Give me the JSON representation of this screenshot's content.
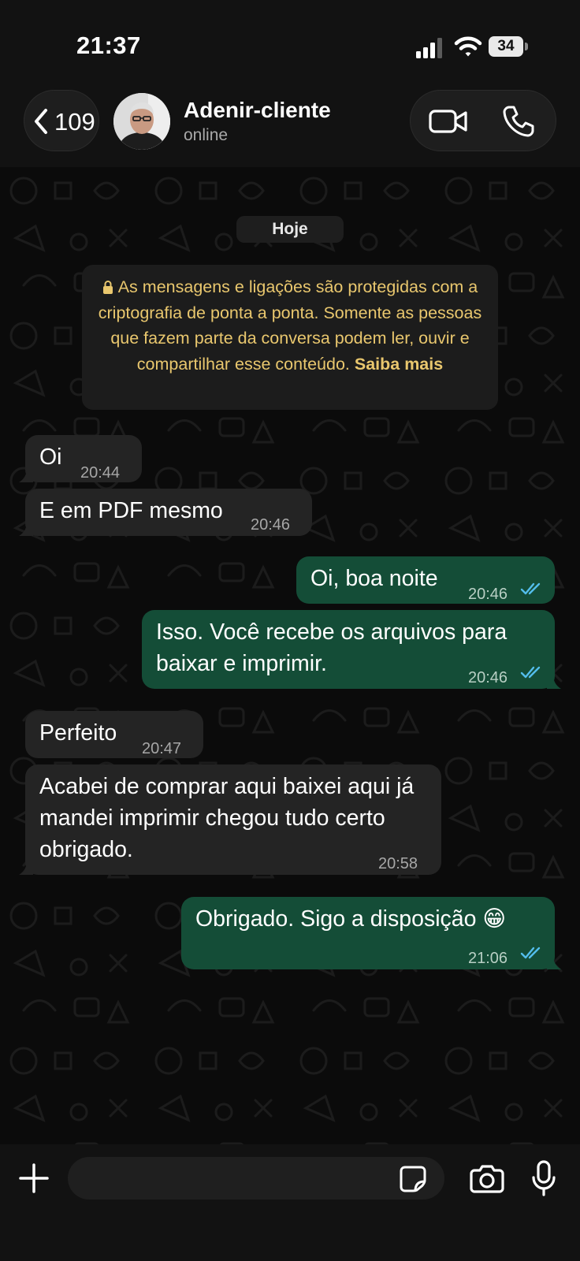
{
  "status_bar": {
    "time": "21:37",
    "battery": "34",
    "icons": [
      "signal-icon",
      "wifi-icon",
      "battery-icon"
    ]
  },
  "header": {
    "back_count": "109",
    "contact_name": "Adenir-cliente",
    "contact_status": "online",
    "icons": [
      "chevron-left-icon",
      "video-call-icon",
      "phone-call-icon"
    ]
  },
  "chat": {
    "date_label": "Hoje",
    "encryption_notice": {
      "text": "As mensagens e ligações são protegidas com a criptografia de ponta a ponta. Somente as pessoas que fazem parte da conversa podem ler, ouvir e compartilhar esse conteúdo.",
      "link": "Saiba mais"
    },
    "messages": [
      {
        "direction": "in",
        "text": "Oi",
        "time": "20:44"
      },
      {
        "direction": "in",
        "text": "E em PDF mesmo",
        "time": "20:46"
      },
      {
        "direction": "out",
        "text": "Oi, boa noite",
        "time": "20:46",
        "status": "read"
      },
      {
        "direction": "out",
        "text": "Isso. Você recebe os arquivos para baixar e imprimir.",
        "time": "20:46",
        "status": "read"
      },
      {
        "direction": "in",
        "text": "Perfeito",
        "time": "20:47"
      },
      {
        "direction": "in",
        "text": "Acabei de comprar aqui baixei aqui já mandei imprimir chegou tudo certo obrigado.",
        "time": "20:58"
      },
      {
        "direction": "out",
        "text": "Obrigado. Sigo a disposição 😁",
        "time": "21:06",
        "status": "read"
      }
    ]
  },
  "input_bar": {
    "placeholder": "",
    "icons": [
      "plus-icon",
      "sticker-icon",
      "camera-icon",
      "microphone-icon"
    ]
  },
  "colors": {
    "incoming_bubble": "#242424",
    "outgoing_bubble": "#144d37",
    "read_ticks": "#53bdeb",
    "notice_text": "#e9c76e"
  }
}
